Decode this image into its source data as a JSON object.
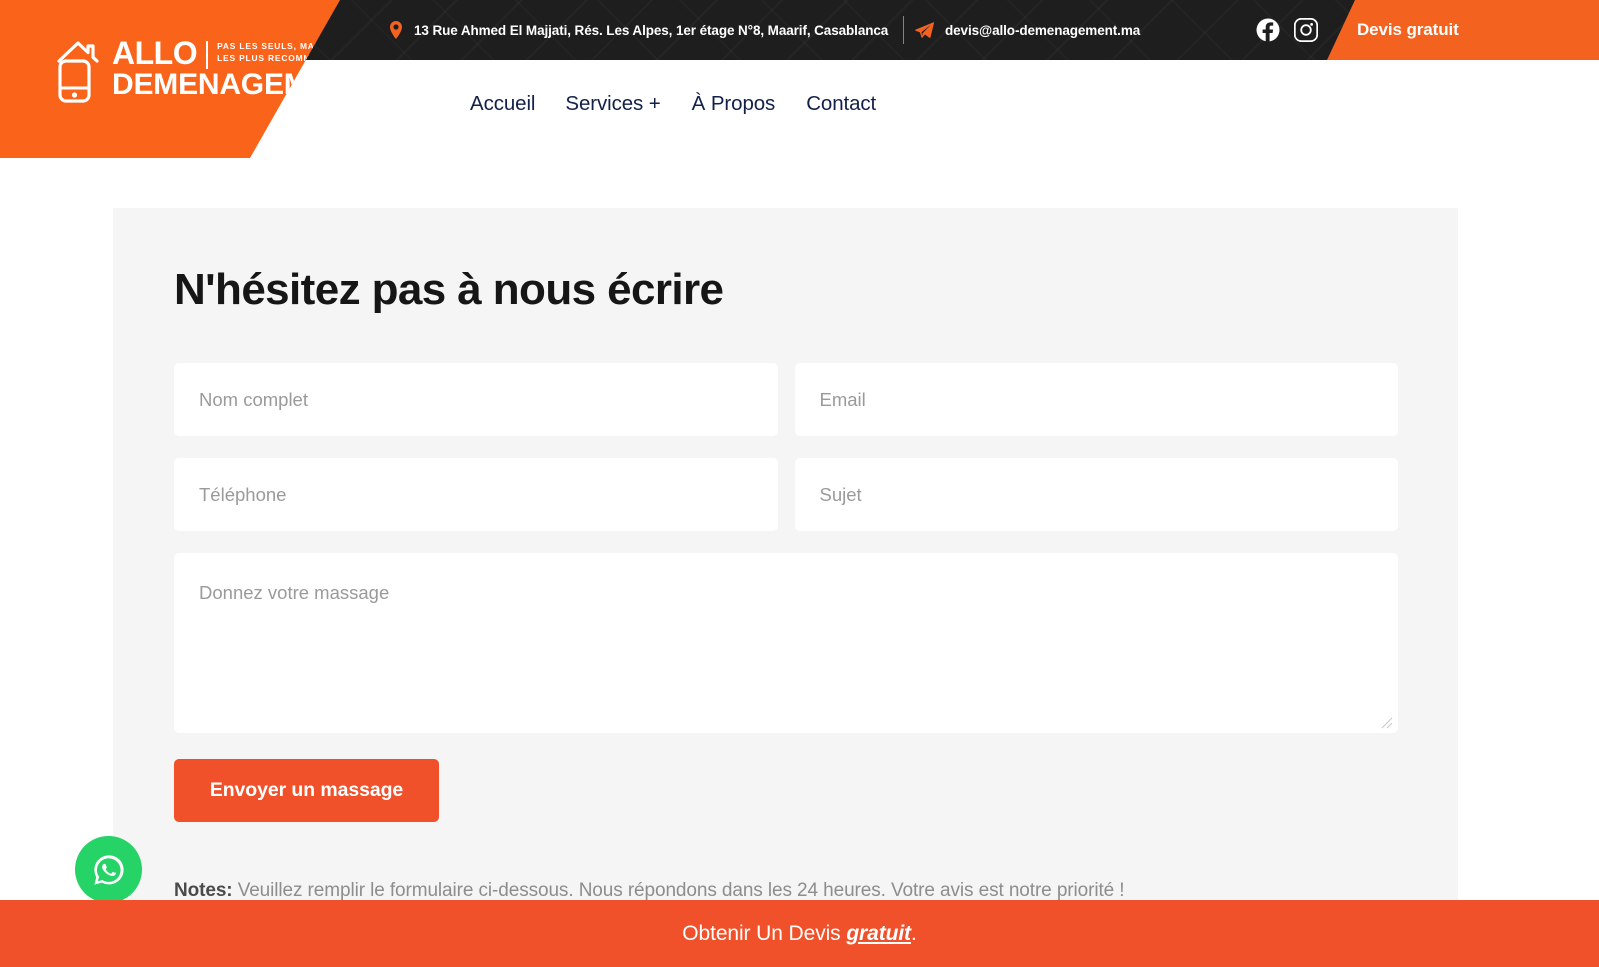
{
  "topbar": {
    "address": "13 Rue Ahmed El Majjati, Rés. Les Alpes, 1er étage N°8, Maarif, Casablanca",
    "email": "devis@allo-demenagement.ma",
    "location_icon": "location-pin-icon",
    "email_icon": "paper-plane-icon",
    "socials": [
      {
        "name": "facebook-icon",
        "label": "Facebook"
      },
      {
        "name": "instagram-icon",
        "label": "Instagram"
      }
    ],
    "cta_label": "Devis gratuit"
  },
  "logo": {
    "name": "ALLO",
    "name2": "DEMENAGEMENT",
    "tagline_line1": "PAS LES SEULS, MAIS",
    "tagline_line2": "LES PLUS RECOMMANDÉS."
  },
  "nav": {
    "items": [
      {
        "label": "Accueil"
      },
      {
        "label": "Services +"
      },
      {
        "label": "À Propos"
      },
      {
        "label": "Contact"
      }
    ]
  },
  "contact_form": {
    "title": "N'hésitez pas à nous écrire",
    "fields": {
      "name_placeholder": "Nom complet",
      "email_placeholder": "Email",
      "phone_placeholder": "Téléphone",
      "subject_placeholder": "Sujet",
      "message_placeholder": "Donnez votre massage"
    },
    "values": {
      "name": "",
      "email": "",
      "phone": "",
      "subject": "",
      "message": ""
    },
    "submit_label": "Envoyer un massage",
    "notes_label": "Notes:",
    "notes_text": " Veuillez remplir le formulaire ci-dessous. Nous répondons dans les 24 heures. Votre avis est notre priorité !"
  },
  "whatsapp": {
    "icon": "whatsapp-icon"
  },
  "bottombar": {
    "text_before": "Obtenir Un Devis ",
    "emphasis": "gratuit",
    "text_after": "."
  },
  "colors": {
    "brand_orange": "#f9641a",
    "cta_orange": "#f4621f",
    "button_orange": "#f0512a",
    "dark_bar": "#1e1e1e",
    "nav_navy": "#12214a",
    "card_grey": "#f5f5f5",
    "whatsapp_green": "#25d366"
  }
}
